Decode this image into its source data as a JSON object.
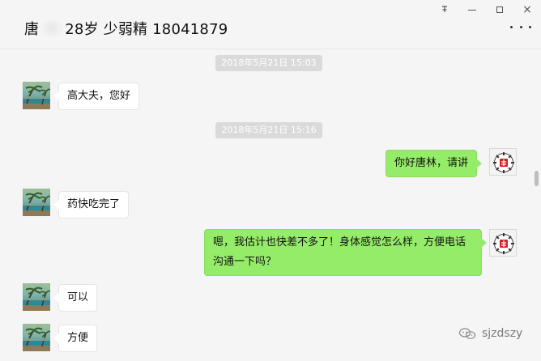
{
  "window": {
    "title": {
      "prefix": "唐",
      "suffix": "28岁 少弱精 18041879"
    },
    "controls": {
      "pin_icon": "pin-icon",
      "minimize_icon": "minimize-icon",
      "maximize_icon": "maximize-icon",
      "close_icon": "close-icon",
      "more_icon": "more-icon"
    }
  },
  "chat": {
    "timestamps": [
      "2018年5月21日 15:03",
      "2018年5月21日 15:16"
    ],
    "messages": [
      {
        "side": "left",
        "text": "高大夫，您好"
      },
      {
        "side": "right",
        "text": "你好唐林，请讲"
      },
      {
        "side": "left",
        "text": "药快吃完了"
      },
      {
        "side": "right",
        "text": "嗯，我估计也快差不多了！身体感觉怎么样，方便电话沟通一下吗？"
      },
      {
        "side": "left",
        "text": "可以"
      },
      {
        "side": "left",
        "text": "方便"
      }
    ]
  },
  "watermark": {
    "text": "sjzdszy"
  },
  "colors": {
    "background": "#f5f5f5",
    "left_bubble": "#ffffff",
    "right_bubble": "#95ec69",
    "timestamp_bg": "#dadada"
  }
}
